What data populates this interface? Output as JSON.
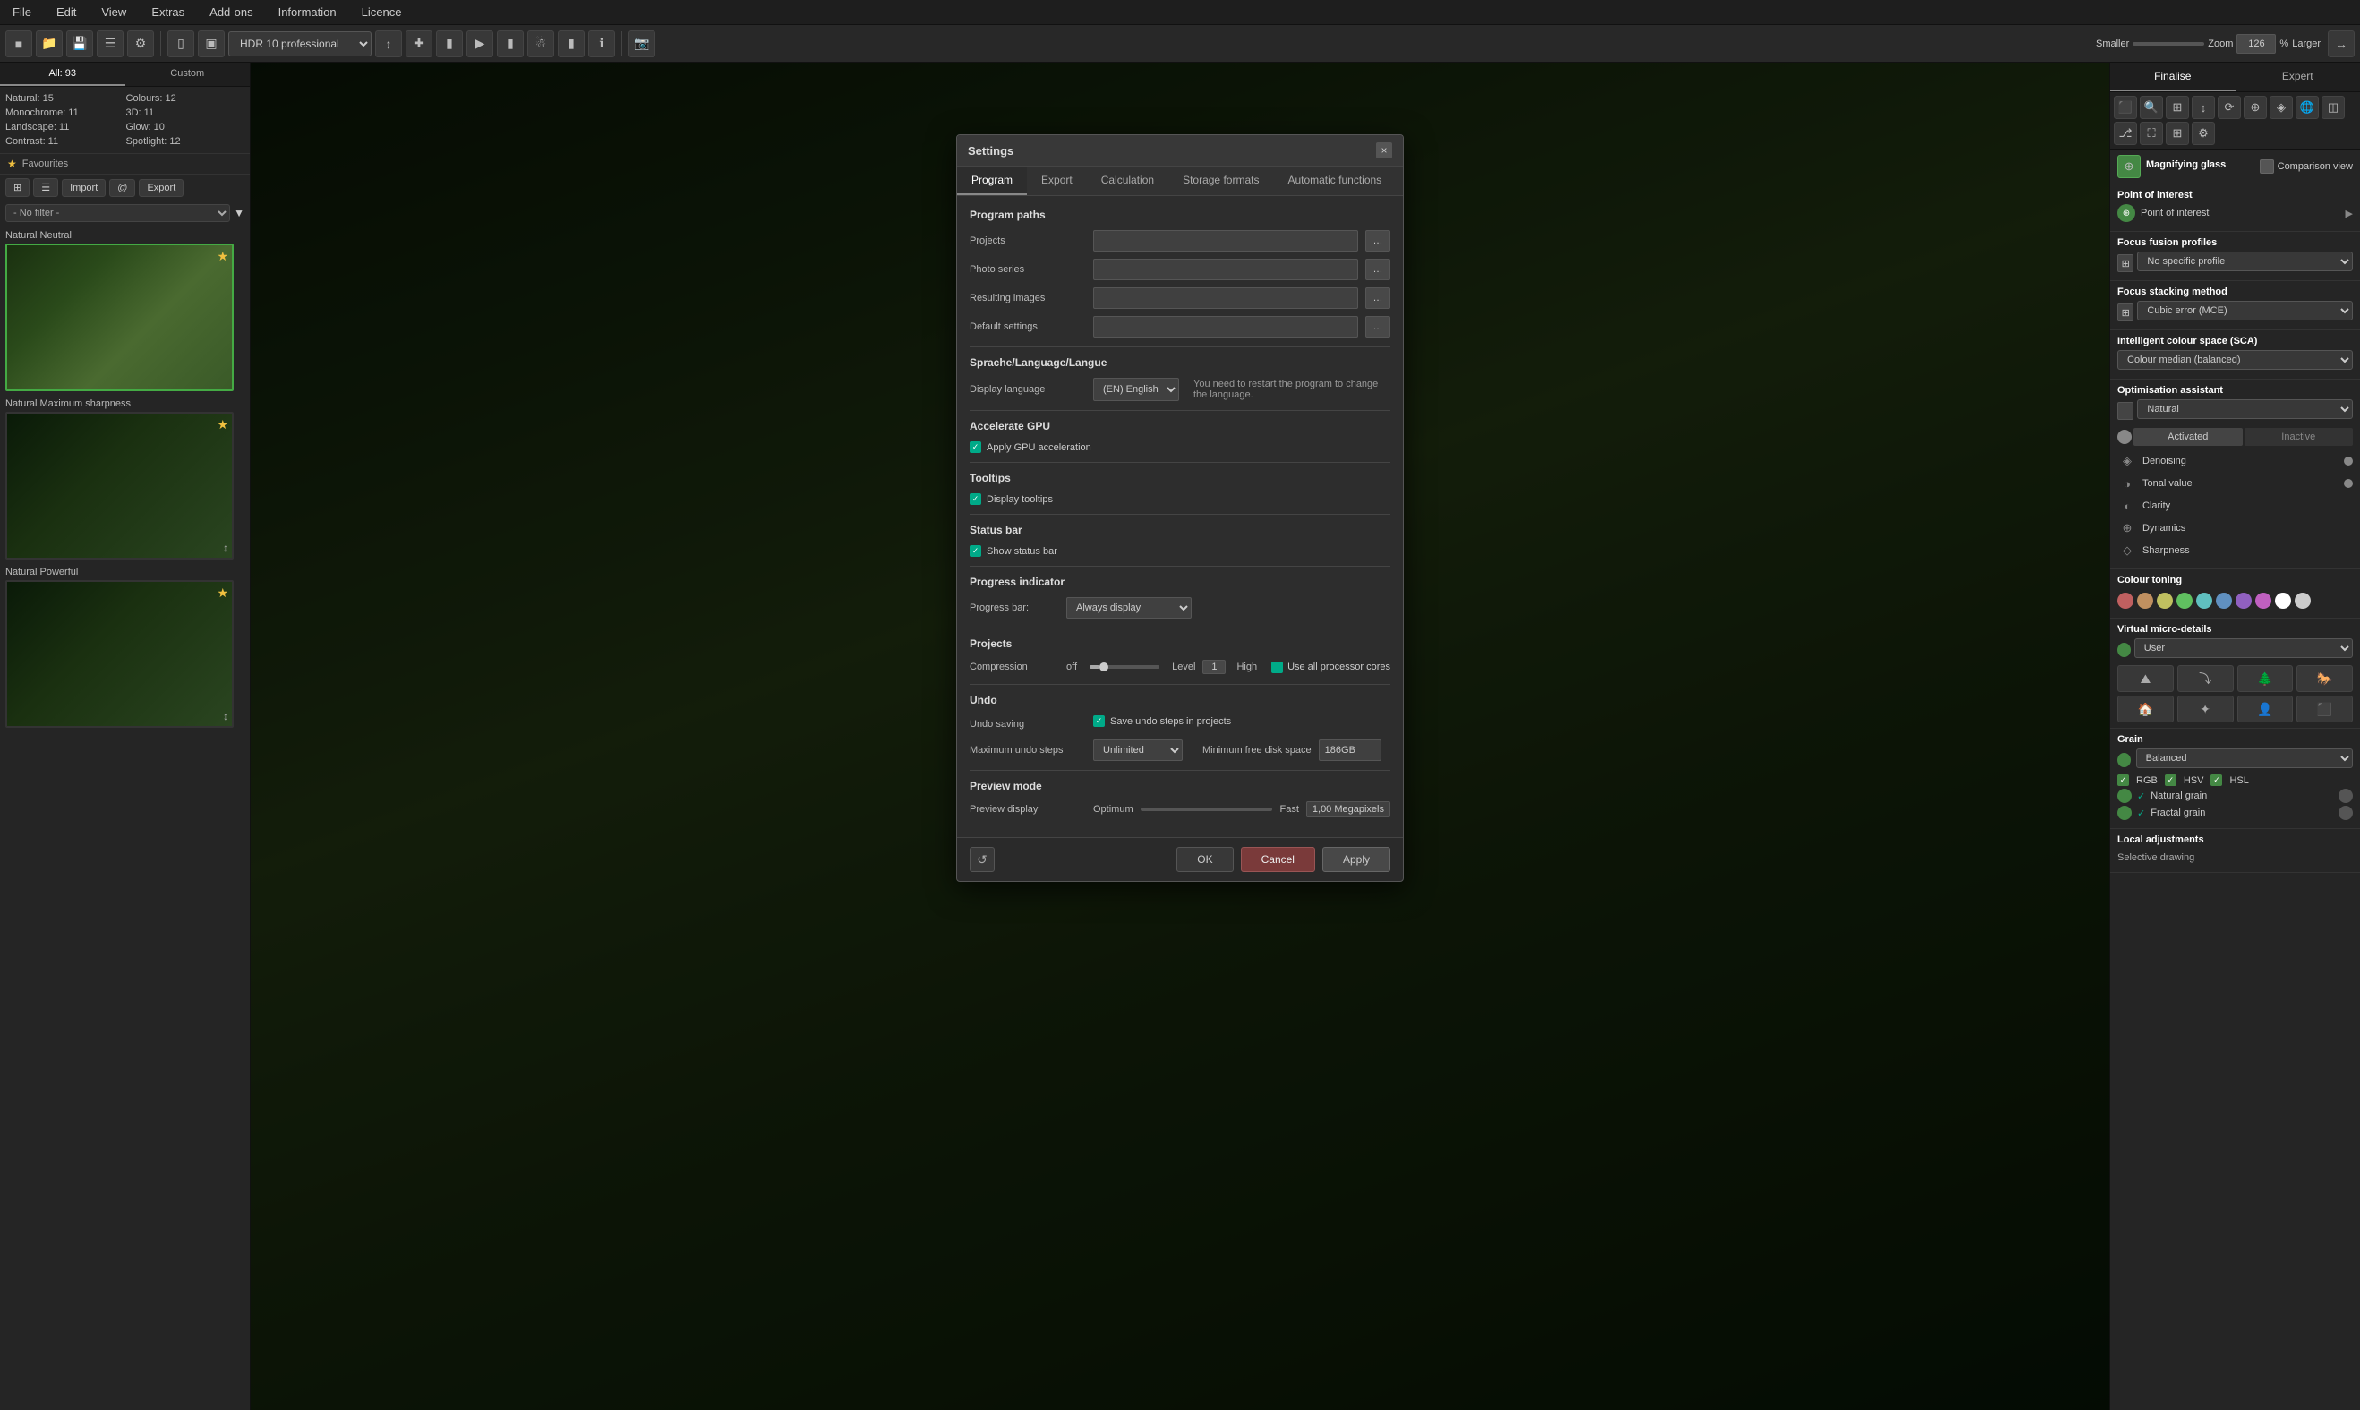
{
  "menubar": {
    "items": [
      "File",
      "Edit",
      "View",
      "Extras",
      "Add-ons",
      "Information",
      "Licence"
    ]
  },
  "toolbar": {
    "preset": "HDR 10 professional",
    "zoom_label": "Zoom",
    "zoom_value": "126",
    "zoom_unit": "%",
    "smaller_label": "Smaller",
    "larger_label": "Larger"
  },
  "left_panel": {
    "tabs": [
      "All: 93",
      "Custom"
    ],
    "stats": [
      {
        "label": "Natural: 15"
      },
      {
        "label": "Colours: 12"
      },
      {
        "label": "Monochrome: 11"
      },
      {
        "label": "3D: 11"
      },
      {
        "label": "Landscape: 11"
      },
      {
        "label": "Glow: 10"
      },
      {
        "label": "Contrast: 11"
      },
      {
        "label": "Spotlight: 12"
      }
    ],
    "favourites": "Favourites",
    "import_label": "Import",
    "export_label": "Export",
    "filter_placeholder": "- No filter -",
    "thumbnails": [
      {
        "label": "Natural Neutral",
        "selected": true
      },
      {
        "label": "Natural Maximum sharpness",
        "selected": false
      },
      {
        "label": "Natural Powerful",
        "selected": false
      }
    ]
  },
  "right_panel": {
    "tabs": [
      "Finalise",
      "Expert"
    ],
    "sections": {
      "magnifying_glass": "Magnifying glass",
      "comparison_view": "Comparison view",
      "point_of_interest": "Point of interest",
      "point_of_interest_label": "Point of interest",
      "focus_fusion_profiles": "Focus fusion profiles",
      "focus_fusion_value": "No specific profile",
      "focus_stacking_method": "Focus stacking method",
      "focus_stacking_value": "Cubic error (MCE)",
      "intelligent_colour_space": "Intelligent colour space (SCA)",
      "colour_median": "Colour median (balanced)",
      "optimisation_assistant": "Optimisation assistant",
      "optimisation_value": "Natural",
      "activated": "Activated",
      "inactive": "Inactive",
      "denoising": "Denoising",
      "tonal_value": "Tonal value",
      "clarity": "Clarity",
      "dynamics": "Dynamics",
      "sharpness": "Sharpness",
      "colour_toning": "Colour toning",
      "user": "User",
      "virtual_micro_details": "Virtual micro-details",
      "grain": "Grain",
      "balanced": "Balanced",
      "natural_grain": "Natural grain",
      "fractal_grain": "Fractal grain",
      "local_adjustments": "Local adjustments",
      "selective_drawing": "Selective drawing"
    },
    "color_dots": [
      "#c06060",
      "#c09060",
      "#c0c060",
      "#60c060",
      "#60c0c0",
      "#6090c0",
      "#9060c0",
      "#c060c0",
      "#ffffff",
      "#cccccc"
    ]
  },
  "modal": {
    "title": "Settings",
    "close_label": "×",
    "tabs": [
      "Program",
      "Export",
      "Calculation",
      "Storage formats",
      "Automatic functions"
    ],
    "active_tab": "Program",
    "program_paths": {
      "heading": "Program paths",
      "projects_label": "Projects",
      "photo_series_label": "Photo series",
      "resulting_images_label": "Resulting images",
      "default_settings_label": "Default settings"
    },
    "language": {
      "heading": "Sprache/Language/Langue",
      "display_language_label": "Display language",
      "language_value": "(EN) English",
      "note": "You need to restart the program to change the language."
    },
    "accelerate_gpu": {
      "heading": "Accelerate GPU",
      "checkbox_label": "Apply GPU acceleration"
    },
    "tooltips": {
      "heading": "Tooltips",
      "checkbox_label": "Display tooltips"
    },
    "status_bar": {
      "heading": "Status bar",
      "checkbox_label": "Show status bar"
    },
    "progress_indicator": {
      "heading": "Progress indicator",
      "label": "Progress bar:",
      "value": "Always display"
    },
    "projects": {
      "heading": "Projects",
      "compression_label": "Compression",
      "off_label": "off",
      "level_label": "Level",
      "level_value": "1",
      "high_label": "High",
      "use_all_label": "Use all processor cores"
    },
    "undo": {
      "heading": "Undo",
      "undo_saving_label": "Undo saving",
      "save_undo_label": "Save undo steps in projects",
      "max_undo_label": "Maximum undo steps",
      "max_undo_value": "Unlimited",
      "min_disk_label": "Minimum free disk space",
      "min_disk_value": "186GB"
    },
    "preview_mode": {
      "heading": "Preview mode",
      "preview_display_label": "Preview display",
      "optimum_label": "Optimum",
      "fast_label": "Fast",
      "megapixels_value": "1,00 Megapixels"
    },
    "footer": {
      "ok_label": "OK",
      "cancel_label": "Cancel",
      "apply_label": "Apply"
    }
  }
}
